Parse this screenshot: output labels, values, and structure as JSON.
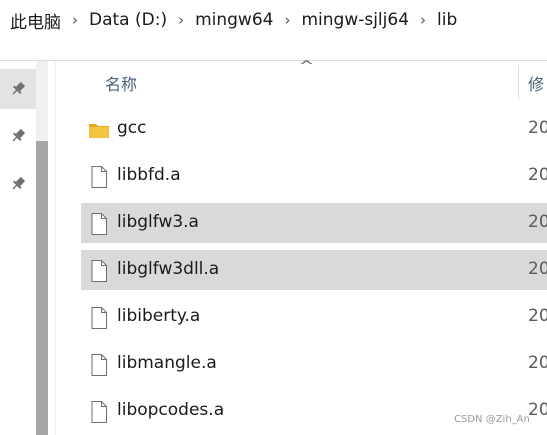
{
  "breadcrumb": {
    "items": [
      "此电脑",
      "Data (D:)",
      "mingw64",
      "mingw-sjlj64",
      "lib"
    ],
    "separator": "›"
  },
  "nav_pane": {
    "pins": [
      {
        "icon": "pin-icon",
        "active": true
      },
      {
        "icon": "pin-icon",
        "active": false
      },
      {
        "icon": "pin-icon",
        "active": false
      }
    ]
  },
  "columns": {
    "name_label": "名称",
    "date_label": "修",
    "sort_indicator": "^"
  },
  "files": [
    {
      "name": "gcc",
      "type": "folder",
      "date": "20",
      "selected": false
    },
    {
      "name": "libbfd.a",
      "type": "file",
      "date": "20",
      "selected": false
    },
    {
      "name": "libglfw3.a",
      "type": "file",
      "date": "20",
      "selected": true
    },
    {
      "name": "libglfw3dll.a",
      "type": "file",
      "date": "20",
      "selected": true
    },
    {
      "name": "libiberty.a",
      "type": "file",
      "date": "20",
      "selected": false
    },
    {
      "name": "libmangle.a",
      "type": "file",
      "date": "20",
      "selected": false
    },
    {
      "name": "libopcodes.a",
      "type": "file",
      "date": "20",
      "selected": false
    }
  ],
  "colors": {
    "selected_row": "#d9d9d9",
    "folder": "#f5c342",
    "header_text": "#4c607a"
  },
  "watermark": "CSDN @Zih_An"
}
